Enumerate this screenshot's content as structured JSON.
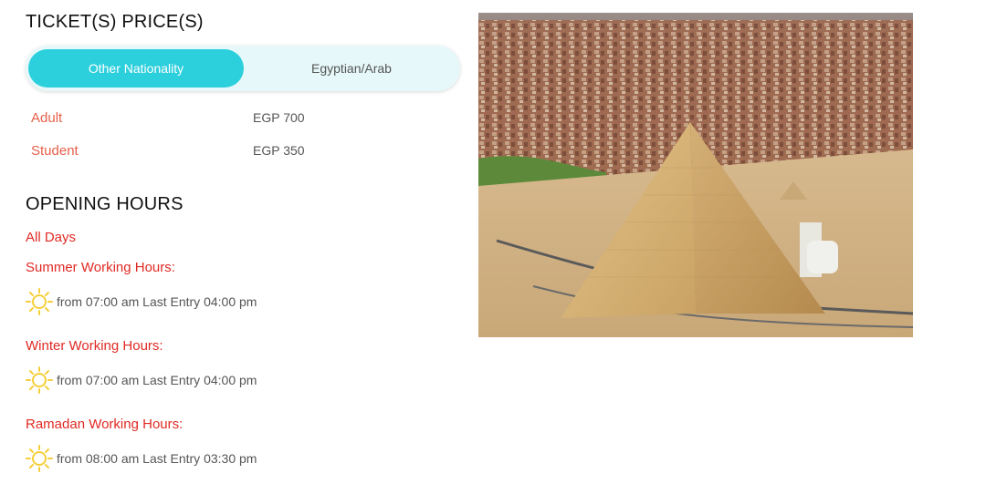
{
  "tickets": {
    "heading": "TICKET(S) PRICE(S)",
    "tabs": [
      {
        "label": "Other Nationality",
        "active": true
      },
      {
        "label": "Egyptian/Arab",
        "active": false
      }
    ],
    "prices": [
      {
        "label": "Adult",
        "value": "EGP 700"
      },
      {
        "label": "Student",
        "value": "EGP 350"
      }
    ]
  },
  "opening_hours": {
    "heading": "OPENING HOURS",
    "all_days": "All Days",
    "sections": [
      {
        "title": "Summer Working Hours:",
        "text": "from 07:00 am Last Entry 04:00 pm",
        "icon": "sun-icon"
      },
      {
        "title": "Winter Working Hours:",
        "text": "from 07:00 am Last Entry 04:00 pm",
        "icon": "sun-icon"
      },
      {
        "title": "Ramadan Working Hours:",
        "text": "from 08:00 am Last Entry 03:30 pm",
        "icon": "sun-icon"
      }
    ]
  },
  "colors": {
    "accent": "#2ccfdc",
    "label_red": "#e02a24",
    "price_label": "#e8604c",
    "sun": "#f5cf3a"
  }
}
